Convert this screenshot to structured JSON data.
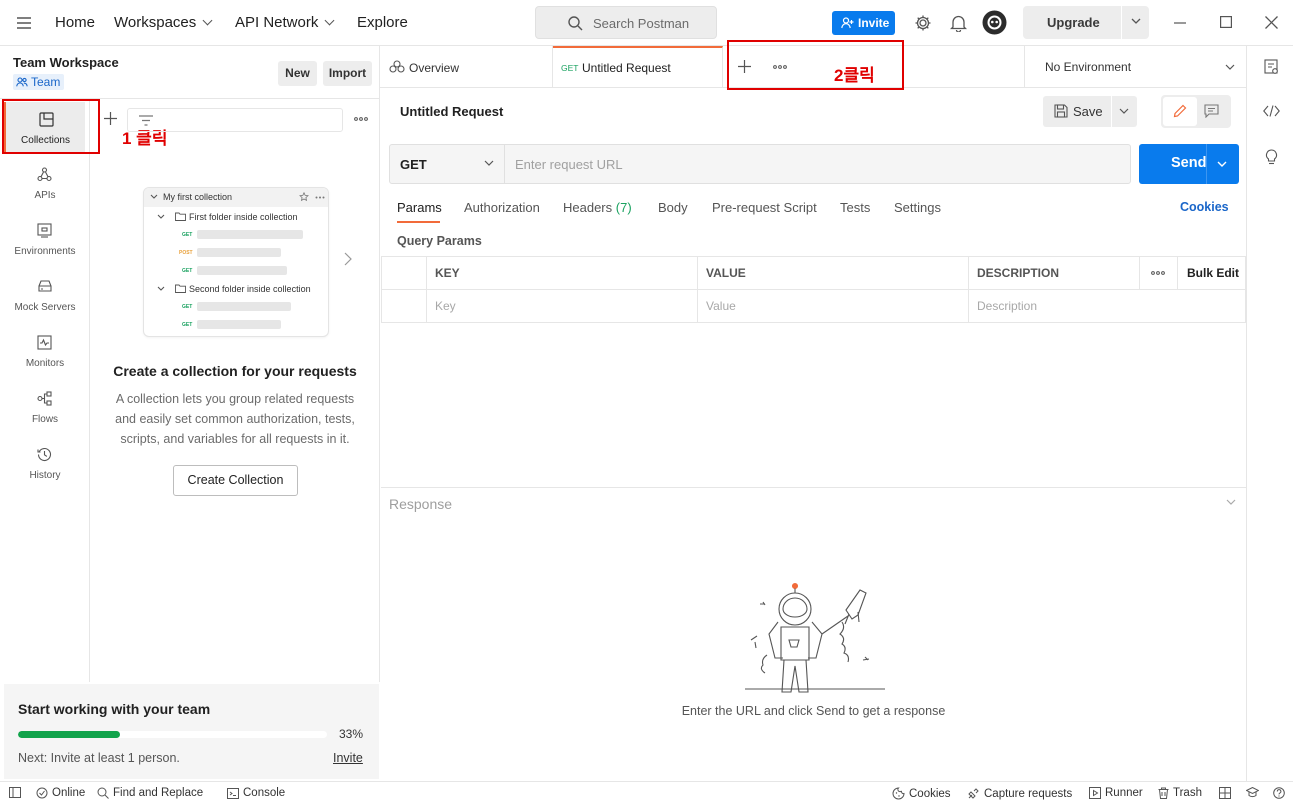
{
  "topbar": {
    "home": "Home",
    "workspaces": "Workspaces",
    "api_network": "API Network",
    "explore": "Explore",
    "search_placeholder": "Search Postman",
    "invite": "Invite",
    "upgrade": "Upgrade"
  },
  "workspace": {
    "title": "Team Workspace",
    "badge": "Team",
    "new_label": "New",
    "import_label": "Import"
  },
  "leftnav": [
    {
      "label": "Collections",
      "icon": "collections-icon"
    },
    {
      "label": "APIs",
      "icon": "apis-icon"
    },
    {
      "label": "Environments",
      "icon": "environments-icon"
    },
    {
      "label": "Mock Servers",
      "icon": "mock-servers-icon"
    },
    {
      "label": "Monitors",
      "icon": "monitors-icon"
    },
    {
      "label": "Flows",
      "icon": "flows-icon"
    },
    {
      "label": "History",
      "icon": "history-icon"
    }
  ],
  "annotations": {
    "step1": "1 클릭",
    "step2": "2클릭"
  },
  "illustration": {
    "collection": "My first collection",
    "folder1": "First folder inside collection",
    "folder2": "Second folder inside collection",
    "m_get": "GET",
    "m_post": "POST"
  },
  "empty_state": {
    "title": "Create a collection for your requests",
    "description": "A collection lets you group related requests and easily set common authorization, tests, scripts, and variables for all requests in it.",
    "button": "Create Collection"
  },
  "team_panel": {
    "title": "Start working with your team",
    "progress": 0.33,
    "progress_label": "33%",
    "next": "Next: Invite at least 1 person.",
    "invite": "Invite"
  },
  "tabs": {
    "overview": "Overview",
    "request_method": "GET",
    "request_name": "Untitled Request",
    "environment": "No Environment"
  },
  "request": {
    "name": "Untitled Request",
    "save": "Save",
    "method": "GET",
    "url_placeholder": "Enter request URL",
    "send": "Send",
    "subtabs": [
      "Params",
      "Authorization",
      "Headers",
      "Body",
      "Pre-request Script",
      "Tests",
      "Settings"
    ],
    "headers_count": "(7)",
    "cookies": "Cookies",
    "query_params_title": "Query Params",
    "columns": {
      "key": "KEY",
      "value": "VALUE",
      "description": "DESCRIPTION",
      "bulk": "Bulk Edit"
    },
    "row_placeholders": {
      "key": "Key",
      "value": "Value",
      "description": "Description"
    }
  },
  "response": {
    "title": "Response",
    "hint": "Enter the URL and click Send to get a response"
  },
  "statusbar": {
    "online": "Online",
    "find_replace": "Find and Replace",
    "console": "Console",
    "cookies": "Cookies",
    "capture": "Capture requests",
    "runner": "Runner",
    "trash": "Trash"
  },
  "colors": {
    "accent_orange": "#f26b3a",
    "brand_blue": "#097bed",
    "annotation_red": "#e00000",
    "progress_green": "#11a34b"
  }
}
